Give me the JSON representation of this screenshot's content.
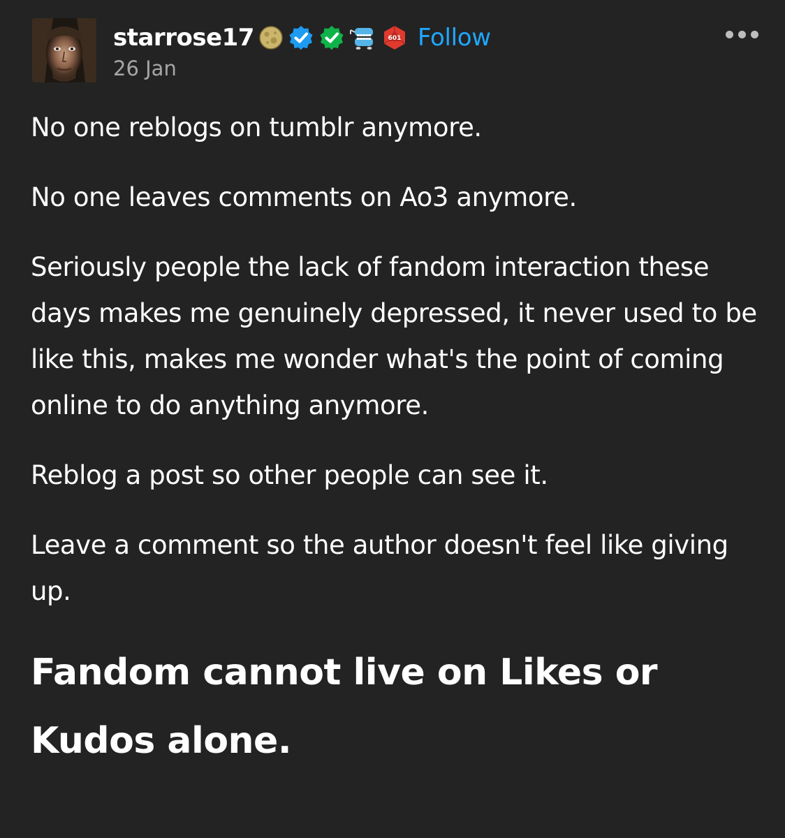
{
  "post": {
    "author": {
      "username": "starrose17",
      "date": "26 Jan",
      "follow_label": "Follow",
      "badges": [
        {
          "name": "moon-badge-icon"
        },
        {
          "name": "blue-verified-checkmark-icon"
        },
        {
          "name": "green-verified-checkmark-icon"
        },
        {
          "name": "wind-up-teeth-badge-icon"
        },
        {
          "name": "d20-dice-badge-icon",
          "text": "601"
        }
      ]
    },
    "more_icon": "ellipsis-icon",
    "paragraphs": [
      "No one reblogs on tumblr anymore.",
      "No one leaves comments on Ao3 anymore.",
      "Seriously people the lack of fandom interaction these days makes me genuinely depressed, it never used to be like this, makes me wonder what's the point of coming online to do anything anymore.",
      "Reblog a post so other people can see it.",
      "Leave a comment so the author doesn't feel like giving up."
    ],
    "headline": "Fandom cannot live on Likes or Kudos alone."
  },
  "colors": {
    "background": "#232323",
    "text": "#ffffff",
    "muted": "#a6a6a6",
    "link": "#1fa7ff",
    "verified_blue": "#1d9bf0",
    "verified_green": "#10b34a",
    "dice_red": "#e03a2f"
  }
}
